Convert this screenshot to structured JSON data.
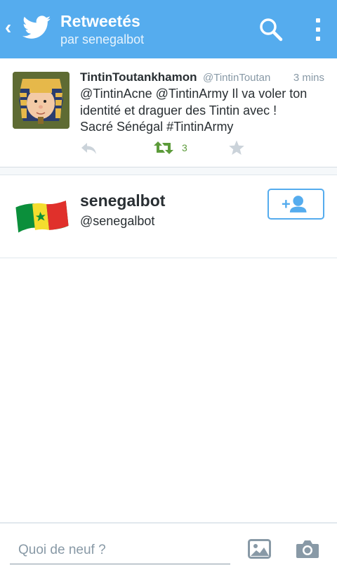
{
  "header": {
    "title": "Retweetés",
    "subtitle": "par senegalbot",
    "back_icon": "back-chevron-icon",
    "logo_icon": "twitter-bird-icon",
    "search_icon": "search-icon",
    "overflow_icon": "overflow-menu-icon",
    "accent_color": "#55acee"
  },
  "tweet": {
    "name": "TintinToutankhamon",
    "handle": "@TintinToutan",
    "time": "3 mins",
    "text_lines": [
      "@TintinAcne @TintinArmy Il va voler ton",
      "identité et draguer des Tintin avec !",
      "Sacré Sénégal #TintinArmy"
    ],
    "retweet_count": "3",
    "actions": [
      "reply-icon",
      "retweet-icon",
      "favorite-icon"
    ]
  },
  "user": {
    "name": "senegalbot",
    "handle": "@senegalbot",
    "follow_icon": "add-user-icon"
  },
  "compose": {
    "placeholder": "Quoi de neuf ?",
    "icons": [
      "photo-icon",
      "camera-icon"
    ]
  }
}
